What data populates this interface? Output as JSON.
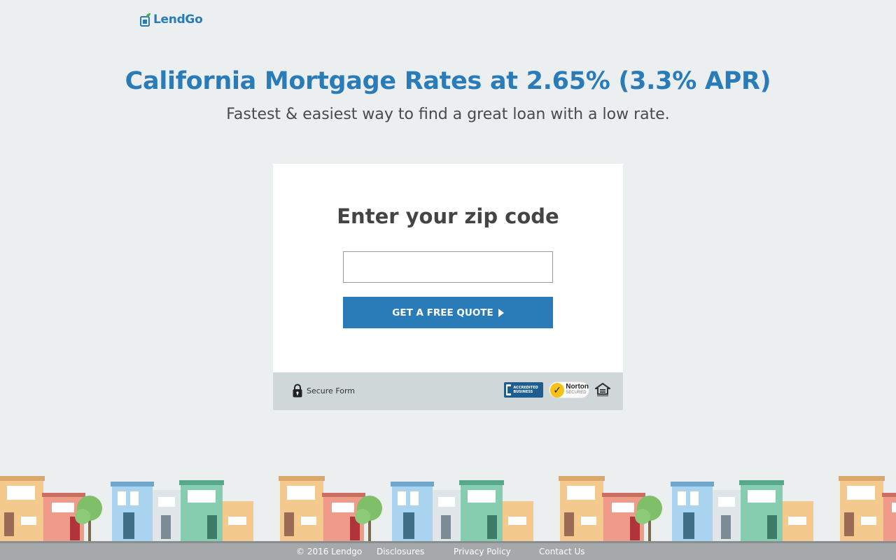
{
  "brand": {
    "name": "LendGo",
    "accent_color": "#2a7cb8"
  },
  "hero": {
    "headline": "California Mortgage Rates at 2.65% (3.3% APR)",
    "subhead": "Fastest & easiest way to find a great loan with a low rate."
  },
  "form": {
    "title": "Enter your zip code",
    "zip_value": "",
    "zip_placeholder": "",
    "submit_label": "GET A FREE QUOTE",
    "secure_label": "Secure Form",
    "badges": {
      "bbb": "ACCREDITED BUSINESS",
      "norton_name": "Norton",
      "norton_sub": "SECURED",
      "eho": "equal-housing-opportunity-icon"
    }
  },
  "footer": {
    "copyright": "© 2016 Lendgo",
    "links": [
      "Disclosures",
      "Privacy Policy",
      "Contact Us"
    ]
  }
}
